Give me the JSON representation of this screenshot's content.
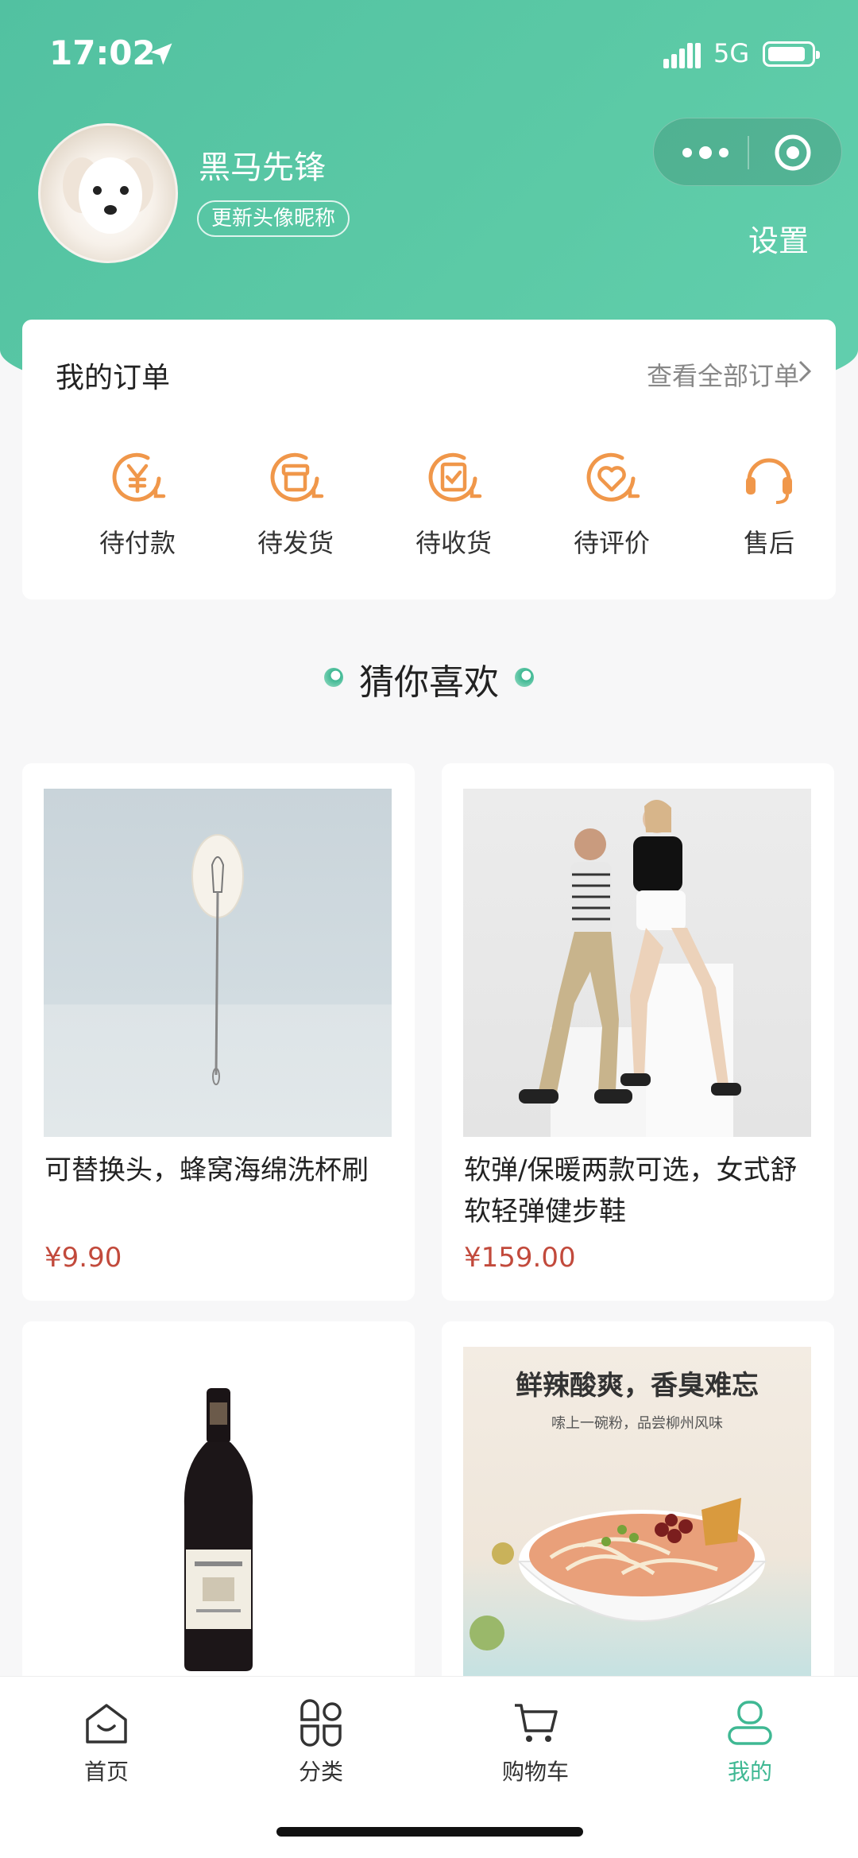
{
  "status_bar": {
    "time": "17:02",
    "network": "5G"
  },
  "profile": {
    "nickname": "黑马先锋",
    "update_label": "更新头像昵称",
    "settings_label": "设置"
  },
  "orders": {
    "title": "我的订单",
    "view_all": "查看全部订单",
    "items": [
      {
        "label": "待付款",
        "icon": "yen-clock-icon"
      },
      {
        "label": "待发货",
        "icon": "box-clock-icon"
      },
      {
        "label": "待收货",
        "icon": "check-clock-icon"
      },
      {
        "label": "待评价",
        "icon": "heart-clock-icon"
      },
      {
        "label": "售后",
        "icon": "headset-icon"
      }
    ],
    "accent_color": "#f0974a"
  },
  "guess": {
    "title": "猜你喜欢"
  },
  "products": [
    {
      "name": "可替换头，蜂窝海绵洗杯刷",
      "price": "¥9.90"
    },
    {
      "name": "软弹/保暖两款可选，女式舒软轻弹健步鞋",
      "price": "¥159.00"
    },
    {
      "name": "",
      "price": ""
    },
    {
      "name": "",
      "price": "",
      "banner_title": "鲜辣酸爽，香臭难忘",
      "banner_sub": "嗦上一碗粉，品尝柳州风味"
    }
  ],
  "tabbar": {
    "items": [
      {
        "label": "首页",
        "icon": "home-icon"
      },
      {
        "label": "分类",
        "icon": "category-icon"
      },
      {
        "label": "购物车",
        "icon": "cart-icon"
      },
      {
        "label": "我的",
        "icon": "user-icon"
      }
    ],
    "active_index": 3,
    "active_color": "#3fb893"
  },
  "colors": {
    "brand_green": "#5ccaa6",
    "price_red": "#c24a3c"
  }
}
